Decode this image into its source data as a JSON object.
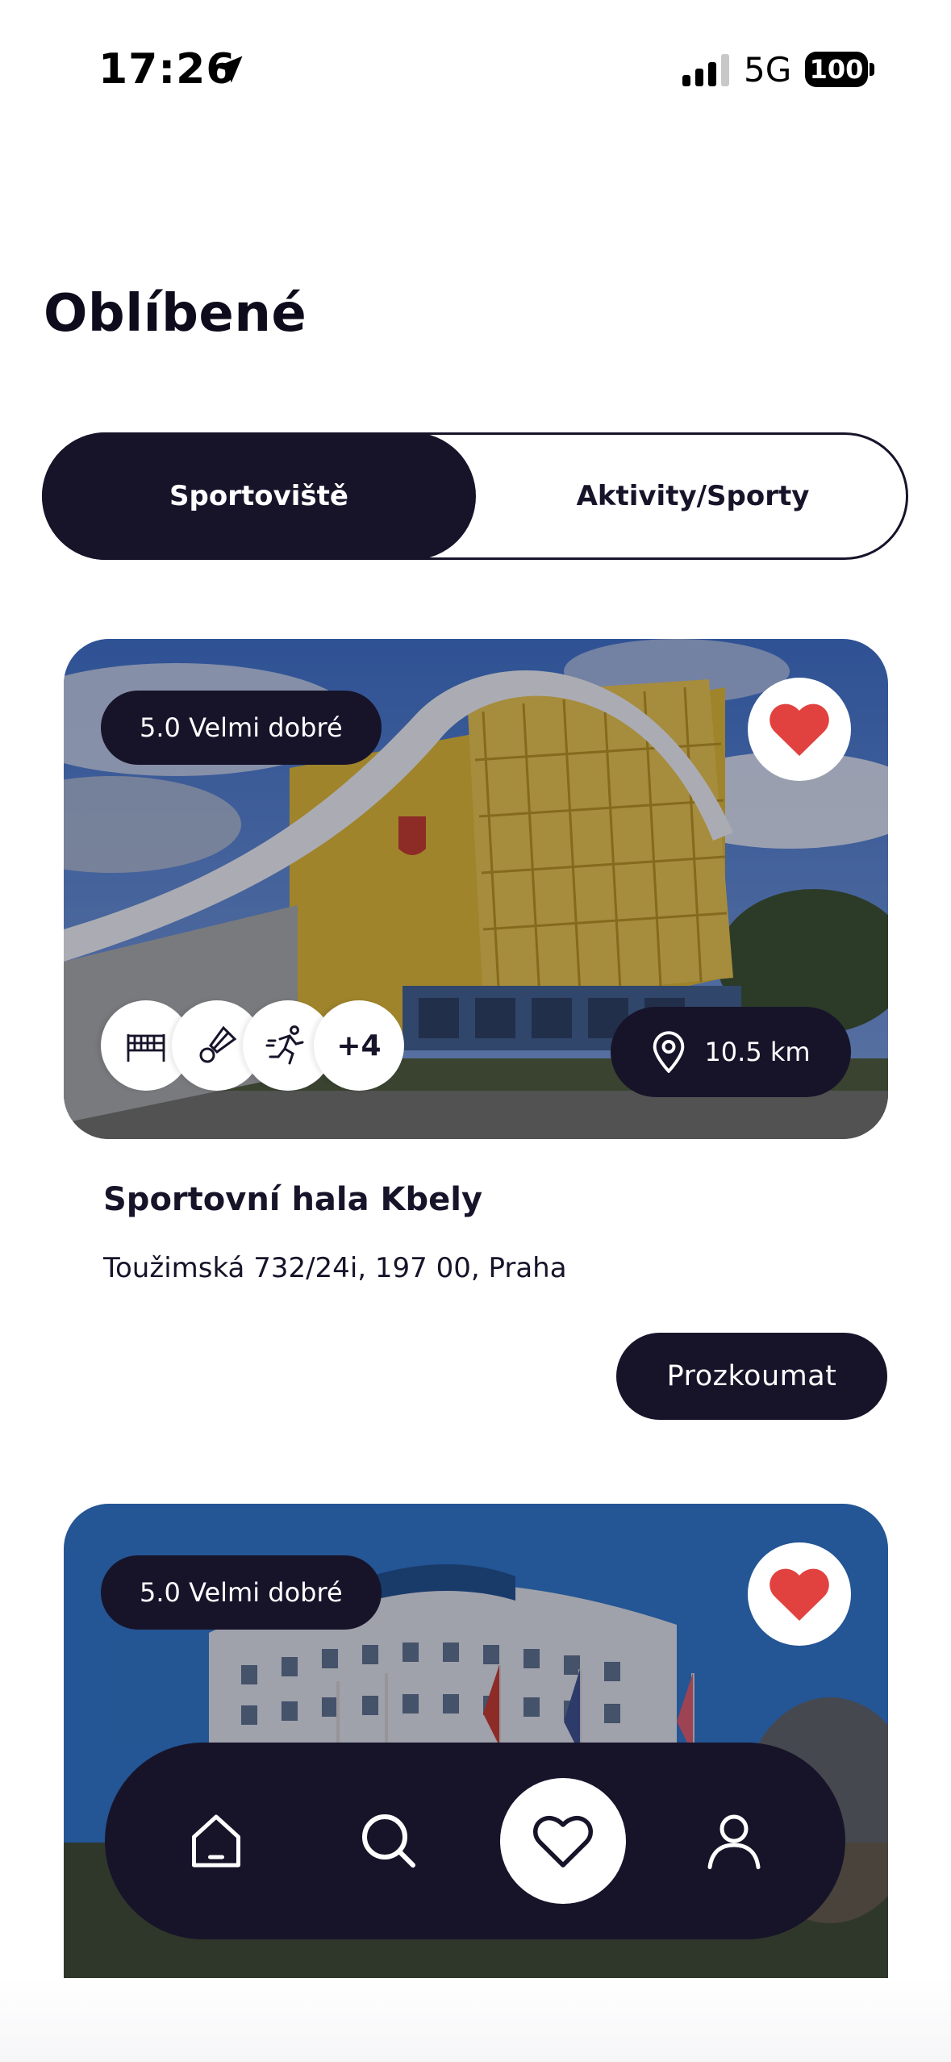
{
  "status_bar": {
    "time": "17:26",
    "network": "5G",
    "battery": "100",
    "icons": [
      "location-arrow-icon",
      "signal-icon",
      "battery-icon"
    ]
  },
  "page": {
    "title": "Oblíbené"
  },
  "tabs": [
    {
      "label": "Sportoviště",
      "active": true
    },
    {
      "label": "Aktivity/Sporty",
      "active": false
    }
  ],
  "venues": [
    {
      "rating_label": "5.0 Velmi dobré",
      "favorite": true,
      "sport_icons": [
        "volleyball-net-icon",
        "badminton-shuttlecock-icon",
        "running-icon"
      ],
      "more_sports": "+4",
      "distance": "10.5 km",
      "name": "Sportovní hala Kbely",
      "address": "Toužimská 732/24i, 197 00, Praha",
      "cta": "Prozkoumat"
    },
    {
      "rating_label": "5.0 Velmi dobré",
      "favorite": true
    }
  ],
  "bottom_nav": [
    {
      "name": "home",
      "icon": "home-icon",
      "active": false
    },
    {
      "name": "search",
      "icon": "search-icon",
      "active": false
    },
    {
      "name": "favorites",
      "icon": "heart-icon",
      "active": true
    },
    {
      "name": "profile",
      "icon": "user-icon",
      "active": false
    }
  ],
  "colors": {
    "primary_dark": "#17142a",
    "heart_red": "#e2423f",
    "background": "#ffffff"
  }
}
